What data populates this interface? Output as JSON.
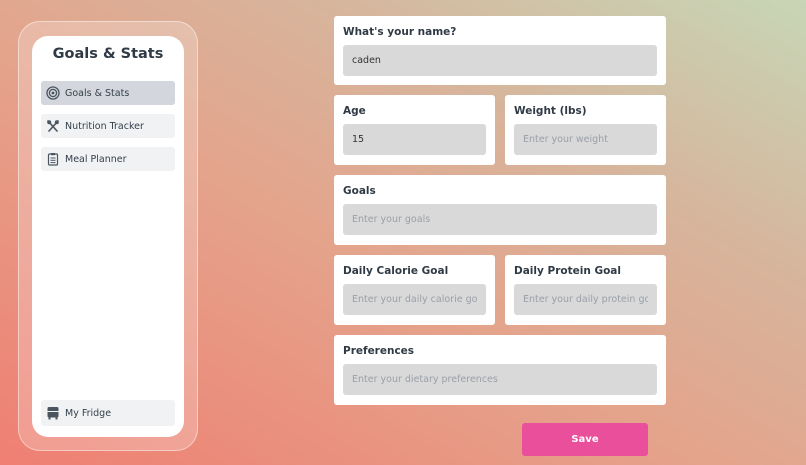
{
  "sidebar": {
    "title": "Goals & Stats",
    "items": [
      {
        "label": "Goals & Stats",
        "icon": "target-icon"
      },
      {
        "label": "Nutrition Tracker",
        "icon": "utensils-icon"
      },
      {
        "label": "Meal Planner",
        "icon": "clipboard-icon"
      }
    ],
    "bottom_item": {
      "label": "My Fridge",
      "icon": "fridge-icon"
    }
  },
  "form": {
    "name": {
      "label": "What's your name?",
      "value": "caden",
      "placeholder": ""
    },
    "age": {
      "label": "Age",
      "value": "15",
      "placeholder": ""
    },
    "weight": {
      "label": "Weight (lbs)",
      "value": "",
      "placeholder": "Enter your weight"
    },
    "goals": {
      "label": "Goals",
      "value": "",
      "placeholder": "Enter your goals"
    },
    "calorie_goal": {
      "label": "Daily Calorie Goal",
      "value": "",
      "placeholder": "Enter your daily calorie goal"
    },
    "protein_goal": {
      "label": "Daily Protein Goal",
      "value": "",
      "placeholder": "Enter your daily protein goal"
    },
    "preferences": {
      "label": "Preferences",
      "value": "",
      "placeholder": "Enter your dietary preferences"
    },
    "save_label": "Save"
  },
  "colors": {
    "accent": "#e94f9b",
    "active_nav": "#d3d6dc",
    "input_bg": "#d9d9d9"
  }
}
